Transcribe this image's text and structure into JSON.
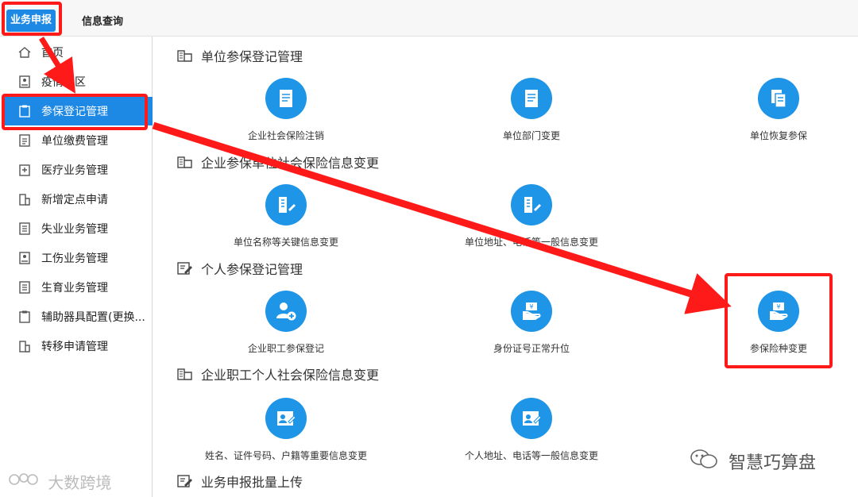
{
  "topnav": {
    "tabs": [
      {
        "label": "业务申报",
        "active": true
      },
      {
        "label": "信息查询",
        "active": false
      }
    ]
  },
  "sidebar": {
    "items": [
      {
        "label": "首页",
        "icon": "home-icon"
      },
      {
        "label": "疫情专区",
        "icon": "id-card-icon"
      },
      {
        "label": "参保登记管理",
        "icon": "clipboard-icon",
        "active": true
      },
      {
        "label": "单位缴费管理",
        "icon": "payment-icon"
      },
      {
        "label": "医疗业务管理",
        "icon": "medical-icon"
      },
      {
        "label": "新增定点申请",
        "icon": "building-icon"
      },
      {
        "label": "失业业务管理",
        "icon": "document-icon"
      },
      {
        "label": "工伤业务管理",
        "icon": "id-card-icon"
      },
      {
        "label": "生育业务管理",
        "icon": "document-icon"
      },
      {
        "label": "辅助器具配置(更换...",
        "icon": "clipboard-icon"
      },
      {
        "label": "转移申请管理",
        "icon": "building-icon"
      }
    ]
  },
  "sections": [
    {
      "title": "单位参保登记管理",
      "items": [
        {
          "label": "企业社会保险注销",
          "icon": "form-icon"
        },
        {
          "label": "单位部门变更",
          "icon": "form-icon"
        },
        {
          "label": "单位恢复参保",
          "icon": "copy-document-icon"
        }
      ]
    },
    {
      "title": "企业参保单位社会保险信息变更",
      "items": [
        {
          "label": "单位名称等关键信息变更",
          "icon": "building-edit-icon"
        },
        {
          "label": "单位地址、电话等一般信息变更",
          "icon": "building-edit-icon"
        }
      ]
    },
    {
      "title": "个人参保登记管理",
      "items": [
        {
          "label": "企业职工参保登记",
          "icon": "add-person-icon"
        },
        {
          "label": "身份证号正常升位",
          "icon": "hand-money-icon"
        },
        {
          "label": "参保险种变更",
          "icon": "hand-money-icon"
        }
      ]
    },
    {
      "title": "企业职工个人社会保险信息变更",
      "items": [
        {
          "label": "姓名、证件号码、户籍等重要信息变更",
          "icon": "person-card-icon"
        },
        {
          "label": "个人地址、电话等一般信息变更",
          "icon": "person-card-icon"
        }
      ]
    },
    {
      "title": "业务申报批量上传",
      "items": []
    }
  ],
  "watermarks": {
    "right": "智慧巧算盘",
    "left": "大数跨境"
  },
  "colors": {
    "primary": "#1e88e5",
    "icon_circle": "#1e95e6",
    "annotation": "#ff1a1a"
  }
}
